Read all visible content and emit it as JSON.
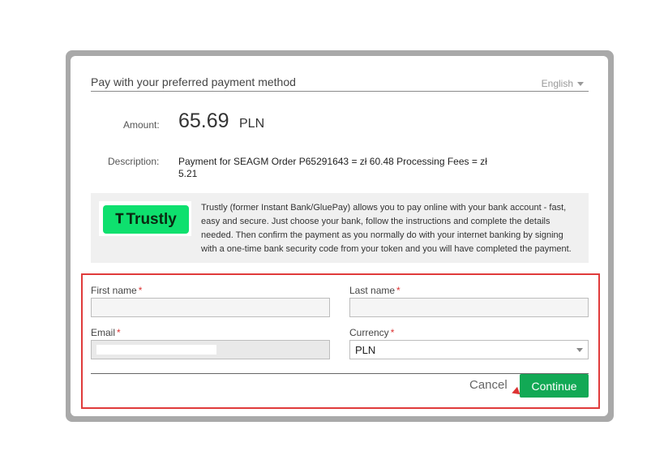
{
  "header": {
    "title": "Pay with your preferred payment method",
    "language": "English"
  },
  "payment": {
    "amount_label": "Amount:",
    "amount_value": "65.69",
    "amount_currency": "PLN",
    "description_label": "Description:",
    "description_text": "Payment for SEAGM Order P65291643 = zł 60.48 Processing Fees = zł 5.21"
  },
  "provider": {
    "logo_text": "Trustly",
    "description": "Trustly (former Instant Bank/GluePay) allows you to pay online with your bank account - fast, easy and secure. Just choose your bank, follow the instructions and complete the details needed. Then confirm the payment as you normally do with your internet banking by signing with a one-time bank security code from your token and you will have completed the payment."
  },
  "form": {
    "first_name_label": "First name",
    "last_name_label": "Last name",
    "email_label": "Email",
    "currency_label": "Currency",
    "required_mark": "*",
    "first_name_value": "",
    "last_name_value": "",
    "currency_value": "PLN",
    "cancel_label": "Cancel",
    "continue_label": "Continue"
  },
  "colors": {
    "primary_button": "#12a955",
    "highlight_border": "#e03b3b",
    "trustly_brand": "#0ee06e"
  }
}
